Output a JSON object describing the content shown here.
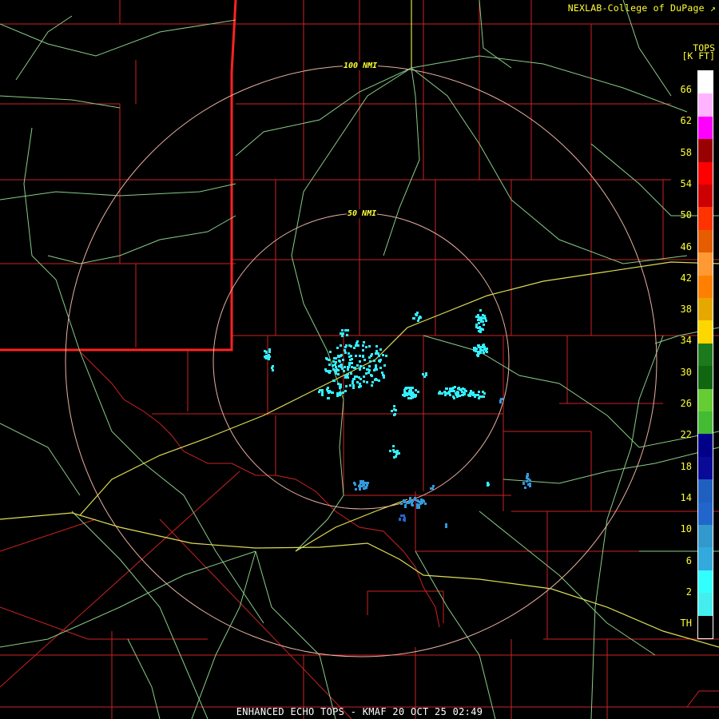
{
  "credit": "NEXLAB-College of DuPage",
  "credit_icon": "chart-icon",
  "legend": {
    "title_line1": "TOPS",
    "title_line2": "[K FT]",
    "labels": [
      "66",
      "62",
      "58",
      "54",
      "50",
      "46",
      "42",
      "38",
      "34",
      "30",
      "26",
      "22",
      "18",
      "14",
      "10",
      "6",
      "2",
      "TH"
    ],
    "colors": [
      "#ffffff",
      "#ffb4ff",
      "#ff00ff",
      "#990000",
      "#ff0000",
      "#cc0000",
      "#ff3300",
      "#e65c00",
      "#ff9933",
      "#ff8000",
      "#e6a800",
      "#ffd700",
      "#1b7a1b",
      "#116611",
      "#66cc33",
      "#44bb33",
      "#000088",
      "#0a0a99",
      "#1f5fbf",
      "#2266cc",
      "#3399cc",
      "#33aadd",
      "#33ffff",
      "#44eeee",
      "#000000"
    ]
  },
  "rings": [
    {
      "label": "100 NMI"
    },
    {
      "label": "50 NMI"
    }
  ],
  "footer": "ENHANCED ECHO TOPS - KMAF 20 OCT 25 02:49",
  "colors": {
    "county": "#cc2222",
    "state": "#ff2222",
    "road": "#88cc88",
    "interstate": "#dddd55",
    "ring": "#e8b0a0",
    "echo_light": "#33eeff",
    "echo_mid": "#3399dd",
    "echo_dark": "#2266cc"
  }
}
